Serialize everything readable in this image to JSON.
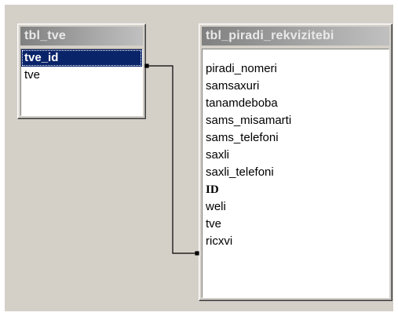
{
  "tables": {
    "tbl_tve": {
      "title": "tbl_tve",
      "fields": [
        {
          "name": "tve_id"
        },
        {
          "name": "tve"
        }
      ]
    },
    "tbl_piradi_rekvizitebi": {
      "title": "tbl_piradi_rekvizitebi",
      "fields": [
        {
          "name": "piradi_nomeri"
        },
        {
          "name": "samsaxuri"
        },
        {
          "name": "tanamdeboba"
        },
        {
          "name": "sams_misamarti"
        },
        {
          "name": "sams_telefoni"
        },
        {
          "name": "saxli"
        },
        {
          "name": "saxli_telefoni"
        },
        {
          "name": "ID"
        },
        {
          "name": "weli"
        },
        {
          "name": "tve"
        },
        {
          "name": "ricxvi"
        }
      ]
    }
  },
  "relationship": {
    "from_table": "tbl_tve",
    "from_field": "tve_id",
    "to_table": "tbl_piradi_rekvizitebi",
    "to_field": "tve"
  },
  "colors": {
    "workspace": "#d4d0c8",
    "selected_row": "#0a246a",
    "title_bar": "#a0a0a0"
  }
}
